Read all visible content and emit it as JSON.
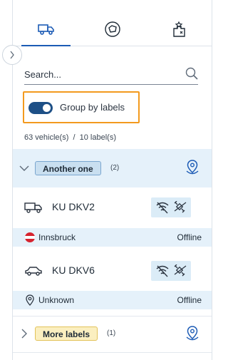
{
  "tabs": [
    {
      "icon": "truck-icon",
      "active": true
    },
    {
      "icon": "geofence-icon",
      "active": false
    },
    {
      "icon": "tasks-icon",
      "active": false
    }
  ],
  "search": {
    "placeholder": "Search..."
  },
  "group_toggle": {
    "label": "Group by labels",
    "on": true
  },
  "counts": {
    "text": "63 vehicle(s)  /  10 label(s)"
  },
  "groups": [
    {
      "label": "Another one",
      "count": "(2)",
      "vehicles": [
        {
          "name": "KU DKV2",
          "icon": "truck-icon",
          "location": "Innsbruck",
          "location_icon": "austria-flag-icon",
          "status": "Offline"
        },
        {
          "name": "KU DKV6",
          "icon": "car-icon",
          "location": "Unknown",
          "location_icon": "location-pin-icon",
          "status": "Offline"
        }
      ]
    },
    {
      "label": "More labels",
      "count": "(1)"
    }
  ],
  "colors": {
    "accent": "#1c5bb5",
    "highlight": "#f39a1e",
    "row_blue": "#e5f1fa"
  }
}
